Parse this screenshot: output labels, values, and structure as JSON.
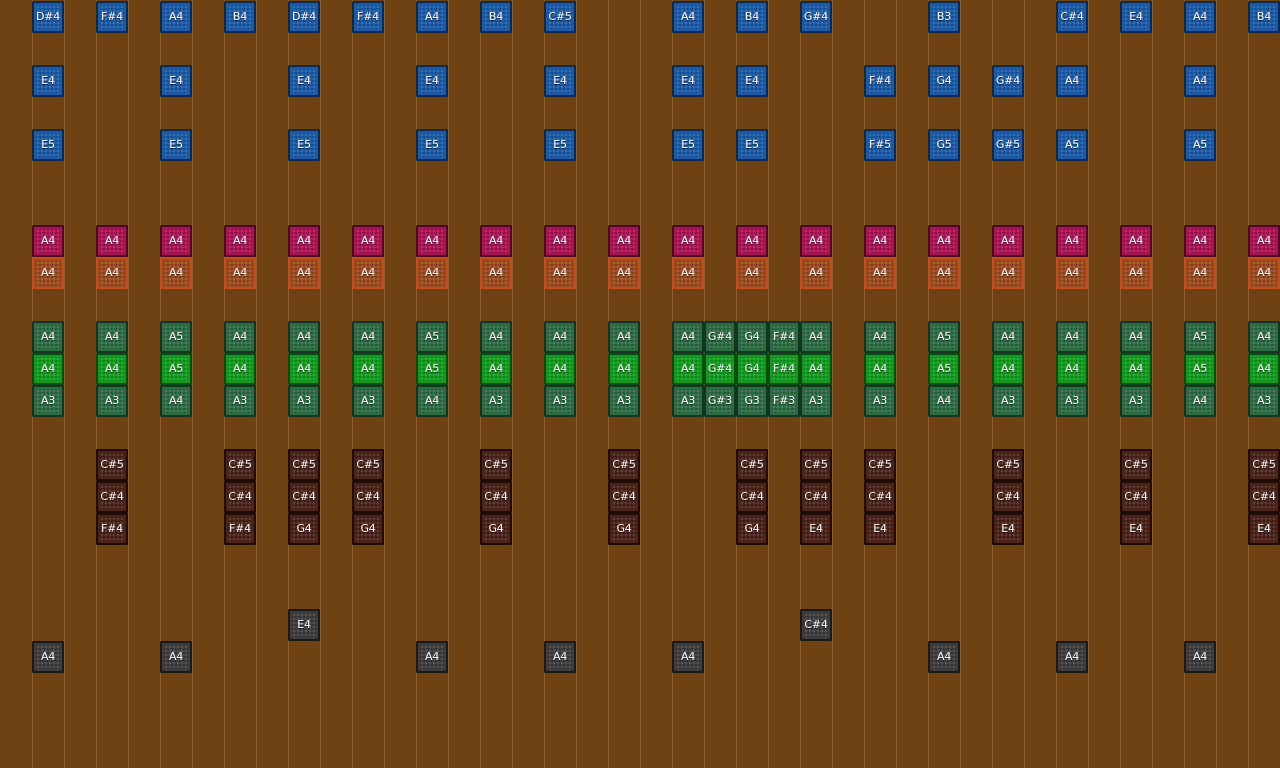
{
  "app": {
    "background_color": "#6f4214",
    "grid_line_color": "#b98750"
  },
  "palette": {
    "blue": "#1a5aa6",
    "magenta": "#aa1455",
    "orange": "#9b4a1e",
    "green": "#2d6b42",
    "lime": "#129b1f",
    "brown": "#4a2218",
    "gray": "#3c3c3c"
  },
  "columns": [
    {
      "top": [
        "D#4",
        "E4",
        "E5"
      ],
      "mag": "A4",
      "org": "A4",
      "green": [
        "A4",
        "A4",
        "A3"
      ],
      "brown": [
        null,
        null,
        null
      ],
      "gray1": null,
      "gray2": "A4"
    },
    {
      "top": [
        "F#4",
        null,
        null
      ],
      "mag": "A4",
      "org": "A4",
      "green": [
        "A4",
        "A4",
        "A3"
      ],
      "brown": [
        "C#5",
        "C#4",
        "F#4"
      ],
      "gray1": null,
      "gray2": null
    },
    {
      "top": [
        "A4",
        "E4",
        "E5"
      ],
      "mag": "A4",
      "org": "A4",
      "green": [
        "A5",
        "A5",
        "A4"
      ],
      "brown": [
        null,
        null,
        null
      ],
      "gray1": null,
      "gray2": "A4"
    },
    {
      "top": [
        "B4",
        null,
        null
      ],
      "mag": "A4",
      "org": "A4",
      "green": [
        "A4",
        "A4",
        "A3"
      ],
      "brown": [
        "C#5",
        "C#4",
        "F#4"
      ],
      "gray1": null,
      "gray2": null
    },
    {
      "top": [
        "D#4",
        "E4",
        "E5"
      ],
      "mag": "A4",
      "org": "A4",
      "green": [
        "A4",
        "A4",
        "A3"
      ],
      "brown": [
        "C#5",
        "C#4",
        "G4"
      ],
      "gray1": "E4",
      "gray2": null
    },
    {
      "top": [
        "F#4",
        null,
        null
      ],
      "mag": "A4",
      "org": "A4",
      "green": [
        "A4",
        "A4",
        "A3"
      ],
      "brown": [
        "C#5",
        "C#4",
        "G4"
      ],
      "gray1": null,
      "gray2": null
    },
    {
      "top": [
        "A4",
        "E4",
        "E5"
      ],
      "mag": "A4",
      "org": "A4",
      "green": [
        "A5",
        "A5",
        "A4"
      ],
      "brown": [
        null,
        null,
        null
      ],
      "gray1": null,
      "gray2": "A4"
    },
    {
      "top": [
        "B4",
        null,
        null
      ],
      "mag": "A4",
      "org": "A4",
      "green": [
        "A4",
        "A4",
        "A3"
      ],
      "brown": [
        "C#5",
        "C#4",
        "G4"
      ],
      "gray1": null,
      "gray2": null
    },
    {
      "top": [
        "C#5",
        "E4",
        "E5"
      ],
      "mag": "A4",
      "org": "A4",
      "green": [
        "A4",
        "A4",
        "A3"
      ],
      "brown": [
        null,
        null,
        null
      ],
      "gray1": null,
      "gray2": "A4"
    },
    {
      "top": [
        null,
        null,
        null
      ],
      "mag": "A4",
      "org": "A4",
      "green": [
        "A4",
        "A4",
        "A3"
      ],
      "brown": [
        "C#5",
        "C#4",
        "G4"
      ],
      "gray1": null,
      "gray2": null
    },
    {
      "top": [
        "A4",
        "E4",
        "E5"
      ],
      "mag": "A4",
      "org": "A4",
      "green": [
        "A4",
        "A4",
        "A3"
      ],
      "brown": [
        null,
        null,
        null
      ],
      "gray1": null,
      "gray2": "A4"
    },
    {
      "top": [
        null,
        null,
        null
      ],
      "mag": null,
      "org": null,
      "green": [
        "G#4",
        "G#4",
        "G#3"
      ],
      "brown": [
        null,
        null,
        null
      ],
      "gray1": null,
      "gray2": null
    },
    {
      "top": [
        "B4",
        "E4",
        "E5"
      ],
      "mag": "A4",
      "org": "A4",
      "green": [
        "G4",
        "G4",
        "G3"
      ],
      "brown": [
        "C#5",
        "C#4",
        "G4"
      ],
      "gray1": null,
      "gray2": null
    },
    {
      "top": [
        null,
        null,
        null
      ],
      "mag": null,
      "org": null,
      "green": [
        "F#4",
        "F#4",
        "F#3"
      ],
      "brown": [
        null,
        null,
        null
      ],
      "gray1": null,
      "gray2": null
    },
    {
      "top": [
        "G#4",
        null,
        null
      ],
      "mag": "A4",
      "org": "A4",
      "green": [
        "A4",
        "A4",
        "A3"
      ],
      "brown": [
        "C#5",
        "C#4",
        "E4"
      ],
      "gray1": "C#4",
      "gray2": null
    },
    {
      "top": [
        null,
        "F#4",
        "F#5"
      ],
      "mag": "A4",
      "org": "A4",
      "green": [
        "A4",
        "A4",
        "A3"
      ],
      "brown": [
        "C#5",
        "C#4",
        "E4"
      ],
      "gray1": null,
      "gray2": null
    },
    {
      "top": [
        "B3",
        "G4",
        "G5"
      ],
      "mag": "A4",
      "org": "A4",
      "green": [
        "A5",
        "A5",
        "A4"
      ],
      "brown": [
        null,
        null,
        null
      ],
      "gray1": null,
      "gray2": "A4"
    },
    {
      "top": [
        null,
        "G#4",
        "G#5"
      ],
      "mag": "A4",
      "org": "A4",
      "green": [
        "A4",
        "A4",
        "A3"
      ],
      "brown": [
        "C#5",
        "C#4",
        "E4"
      ],
      "gray1": null,
      "gray2": null
    },
    {
      "top": [
        "C#4",
        "A4",
        "A5"
      ],
      "mag": "A4",
      "org": "A4",
      "green": [
        "A4",
        "A4",
        "A3"
      ],
      "brown": [
        null,
        null,
        null
      ],
      "gray1": null,
      "gray2": "A4"
    },
    {
      "top": [
        "E4",
        null,
        null
      ],
      "mag": "A4",
      "org": "A4",
      "green": [
        "A4",
        "A4",
        "A3"
      ],
      "brown": [
        "C#5",
        "C#4",
        "E4"
      ],
      "gray1": null,
      "gray2": null
    },
    {
      "top": [
        "A4",
        "A4",
        "A5"
      ],
      "mag": "A4",
      "org": "A4",
      "green": [
        "A5",
        "A5",
        "A4"
      ],
      "brown": [
        null,
        null,
        null
      ],
      "gray1": null,
      "gray2": "A4"
    },
    {
      "top": [
        "B4",
        null,
        null
      ],
      "mag": "A4",
      "org": "A4",
      "green": [
        "A4",
        "A4",
        "A3"
      ],
      "brown": [
        "C#5",
        "C#4",
        "E4"
      ],
      "gray1": null,
      "gray2": null
    }
  ]
}
